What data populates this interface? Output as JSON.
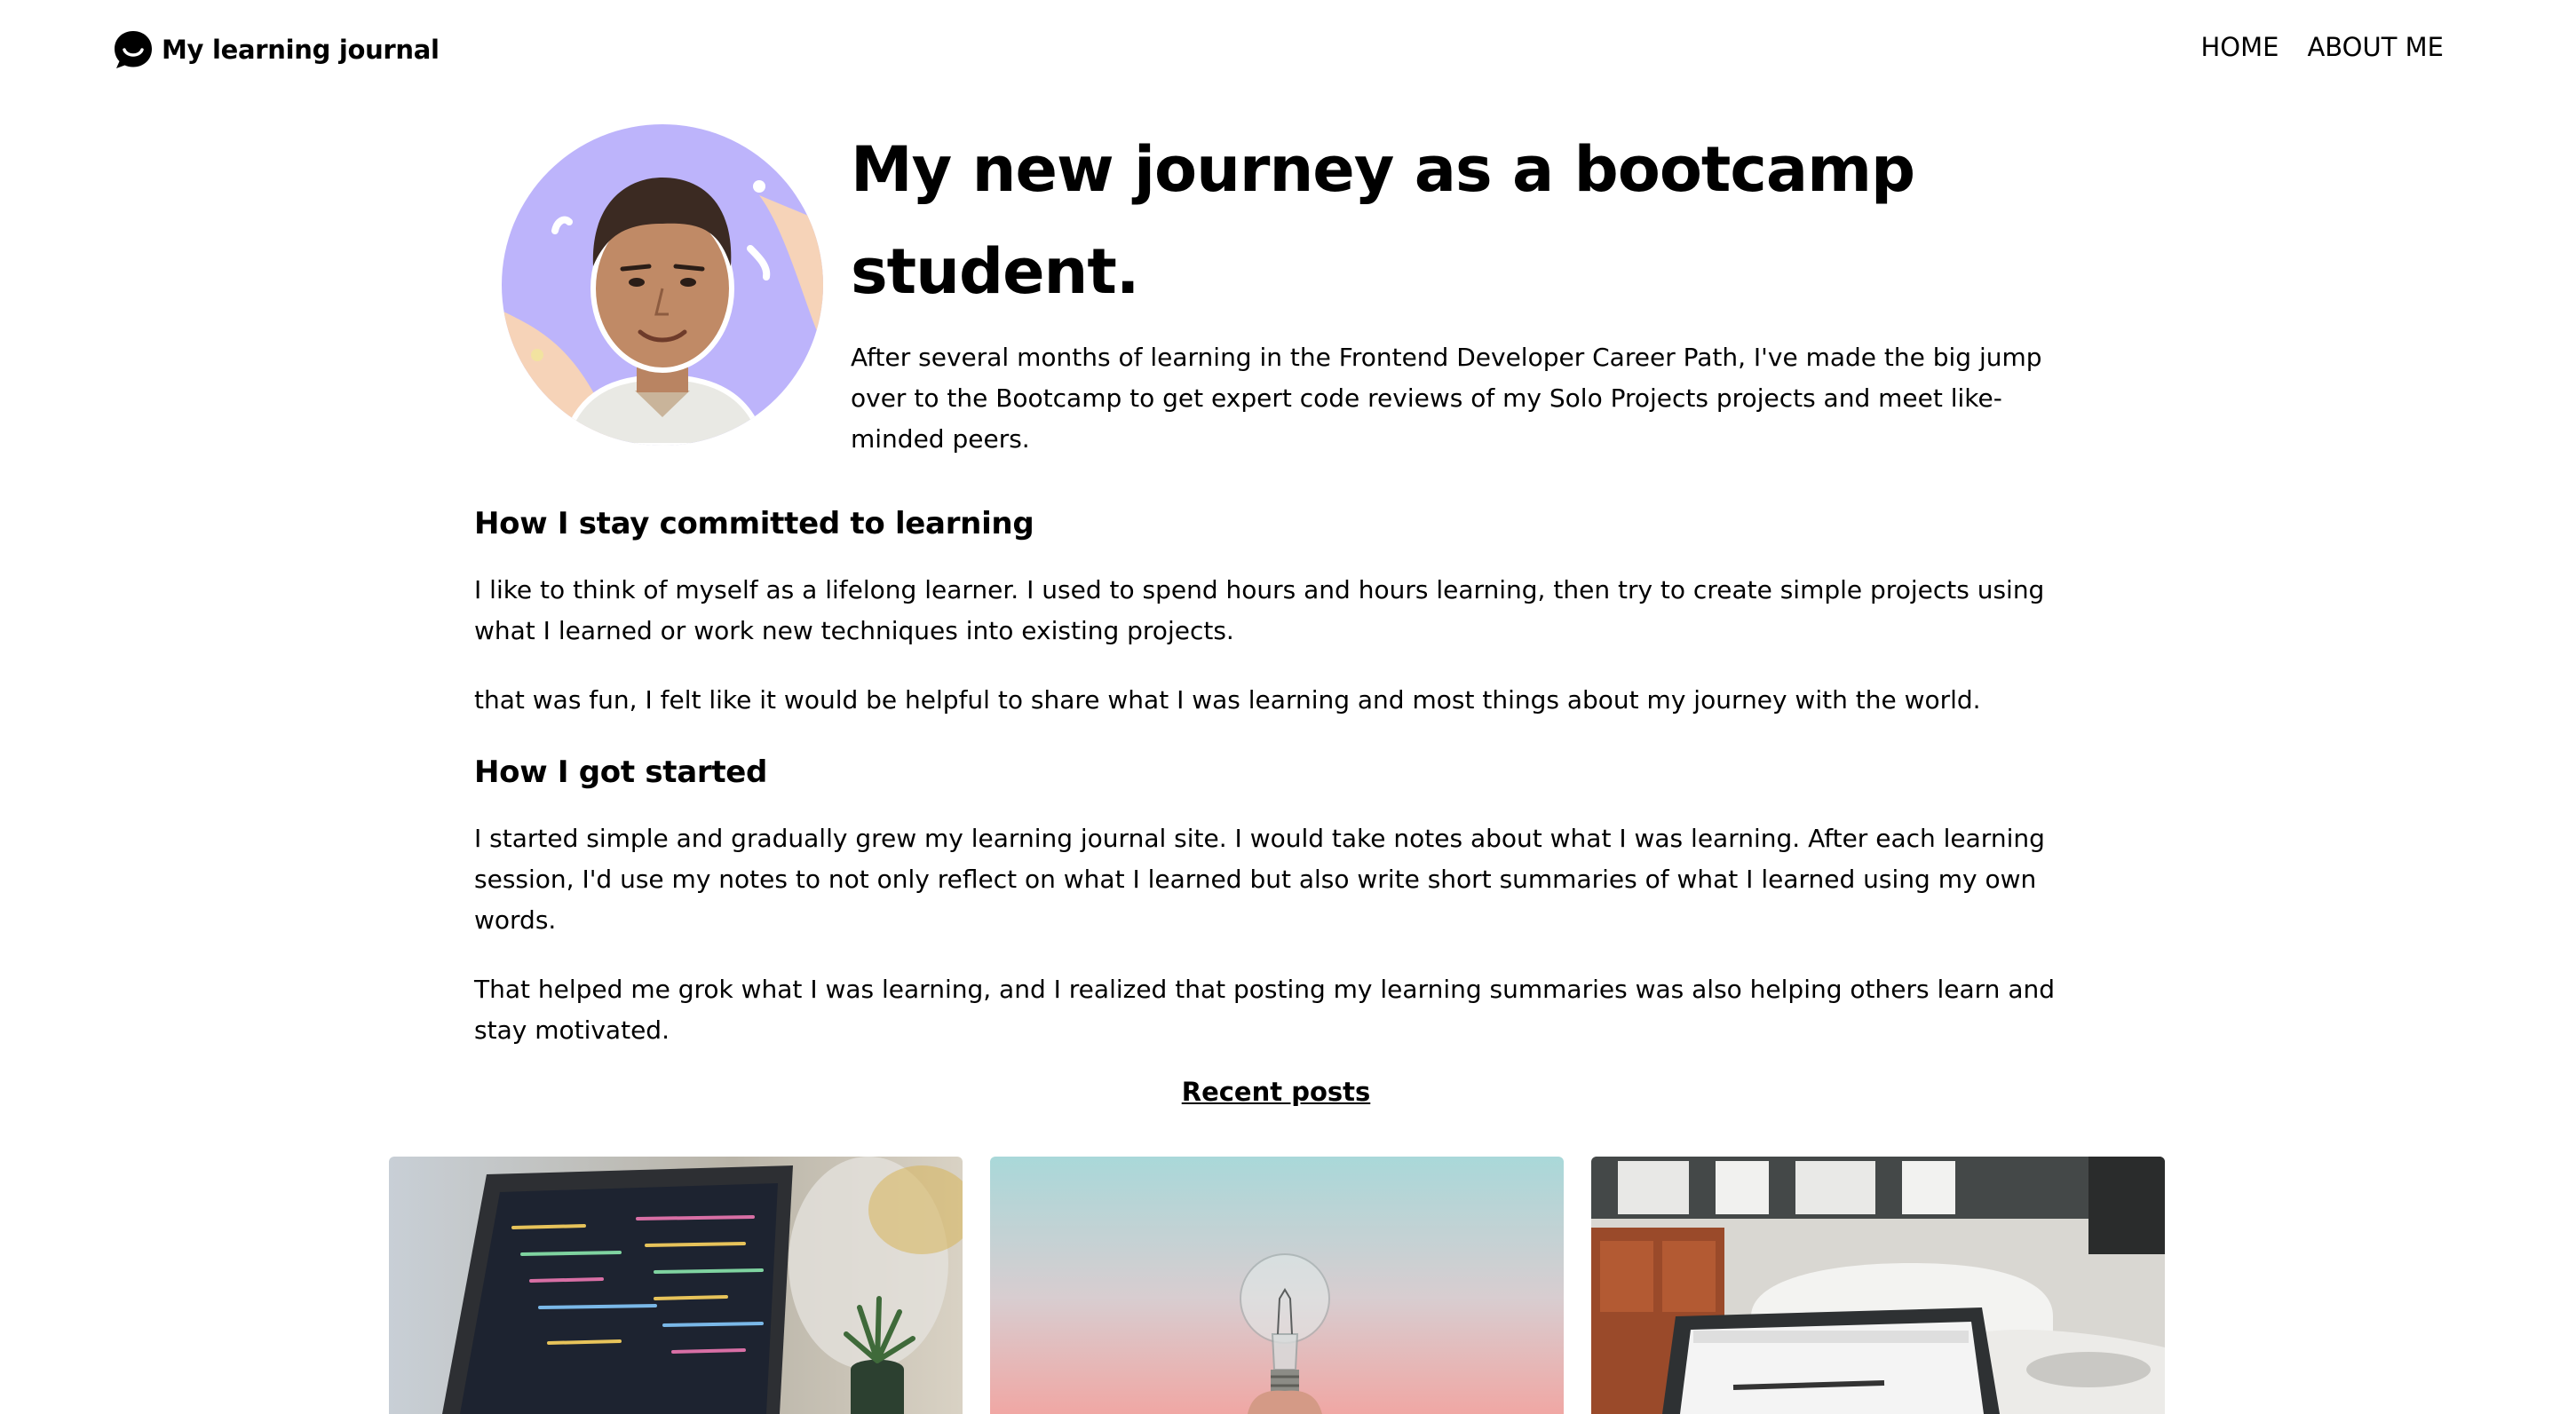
{
  "site": {
    "title": "My learning journal",
    "logo_icon": "chat-bubble-smile-icon"
  },
  "nav": {
    "items": [
      {
        "label": "HOME"
      },
      {
        "label": "ABOUT ME"
      }
    ]
  },
  "hero": {
    "avatar_icon": "author-avatar",
    "title": "My new journey as a bootcamp student.",
    "intro": "After several months of learning in the Frontend Developer Career Path, I've made the big jump over to the Bootcamp to get expert code reviews of my Solo Projects projects and meet like-minded peers."
  },
  "article": {
    "section1": {
      "heading": "How I stay committed to learning",
      "paragraphs": [
        "I like to think of myself as a lifelong learner. I used to spend hours and hours learning, then try to create simple projects using what I learned or work new techniques into existing projects.",
        "that was fun, I felt like it would be helpful to share what I was learning and most things about my journey with the world."
      ]
    },
    "section2": {
      "heading": "How I got started",
      "paragraphs": [
        "I started simple and gradually grew my learning journal site. I would take notes about what I was learning. After each learning session, I'd use my notes to not only reflect on what I learned but also write short summaries of what I learned using my own words.",
        "That helped me grok what I was learning, and I realized that posting my learning summaries was also helping others learn and stay motivated."
      ]
    }
  },
  "recent_posts": {
    "heading": "Recent posts",
    "cards": [
      {
        "image": "laptop-code-photo"
      },
      {
        "image": "lightbulb-photo"
      },
      {
        "image": "laptop-workspace-photo"
      }
    ]
  },
  "colors": {
    "text": "#000000",
    "background": "#ffffff",
    "avatar_purple": "#bdb4fb",
    "avatar_peach": "#f6d3b8"
  }
}
